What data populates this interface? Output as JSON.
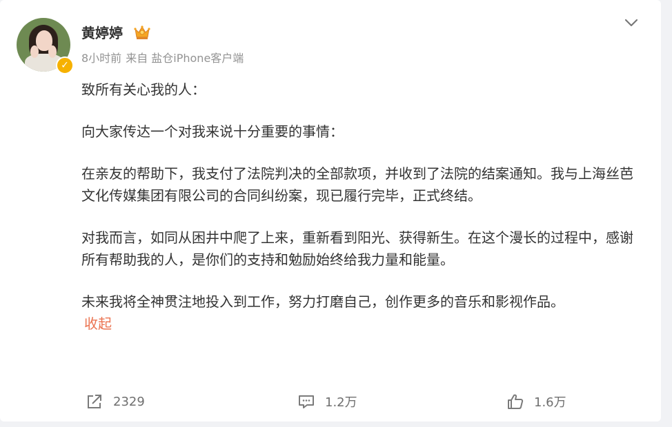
{
  "post": {
    "username": "黄婷婷",
    "time": "8小时前",
    "source": "来自 盐仓iPhone客户端",
    "paragraphs": [
      "致所有关心我的人：",
      "向大家传达一个对我来说十分重要的事情：",
      "在亲友的帮助下，我支付了法院判决的全部款项，并收到了法院的结案通知。我与上海丝芭文化传媒集团有限公司的合同纠纷案，现已履行完毕，正式终结。",
      "对我而言，如同从困井中爬了上来，重新看到阳光、获得新生。在这个漫长的过程中，感谢所有帮助我的人，是你们的支持和勉励始终给我力量和能量。",
      "未来我将全神贯注地投入到工作，努力打磨自己，创作更多的音乐和影视作品。"
    ],
    "collapse_label": "收起"
  },
  "actions": {
    "share_count": "2329",
    "comment_count": "1.2万",
    "like_count": "1.6万"
  },
  "icons": {
    "verified": "verified-badge-icon",
    "crown": "crown-icon",
    "chevron": "chevron-down-icon",
    "share": "share-icon",
    "comment": "comment-icon",
    "like": "thumbs-up-icon"
  },
  "colors": {
    "accent": "#eb7350",
    "verified": "#f6b100",
    "text": "#333333",
    "muted": "#939393"
  }
}
